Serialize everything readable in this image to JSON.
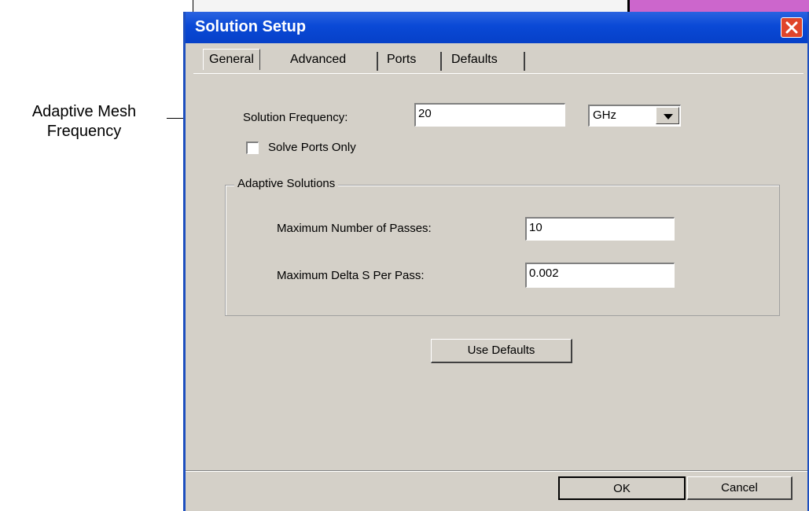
{
  "annotation": {
    "line1": "Adaptive Mesh",
    "line2": "Frequency"
  },
  "dialog": {
    "title": "Solution Setup",
    "tabs": [
      {
        "label": "General",
        "active": true
      },
      {
        "label": "Advanced",
        "active": false
      },
      {
        "label": "Ports",
        "active": false
      },
      {
        "label": "Defaults",
        "active": false
      }
    ],
    "general": {
      "solution_frequency_label": "Solution Frequency:",
      "solution_frequency_value": "20",
      "frequency_unit": "GHz",
      "solve_ports_only_label": "Solve Ports Only",
      "solve_ports_only_checked": false,
      "adaptive_group_title": "Adaptive Solutions",
      "max_passes_label": "Maximum Number of Passes:",
      "max_passes_value": "10",
      "max_delta_label": "Maximum Delta S Per Pass:",
      "max_delta_value": "0.002",
      "use_defaults_label": "Use Defaults"
    },
    "footer": {
      "ok_label": "OK",
      "cancel_label": "Cancel"
    },
    "colors": {
      "titlebar": "#0a49d6",
      "face": "#d4d0c8",
      "close": "#e0452a"
    }
  }
}
